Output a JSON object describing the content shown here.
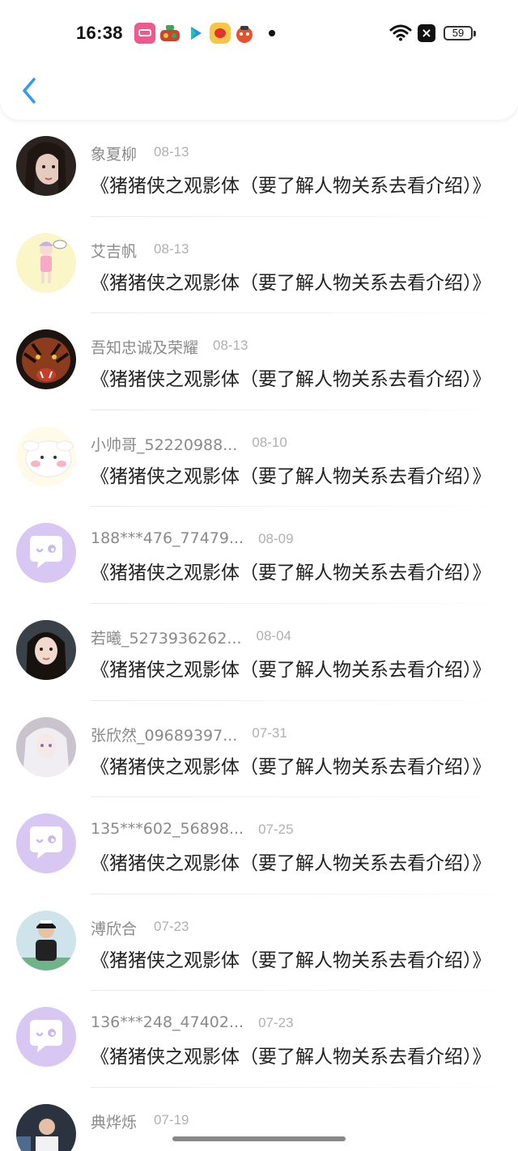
{
  "status_bar": {
    "time": "16:38",
    "battery": "59"
  },
  "header": {
    "back_icon": "chevron-left-icon",
    "accent": "#2c9cf0"
  },
  "avatar_bg": {
    "placeholder": "#d8c7f3"
  },
  "rows": [
    {
      "name": "象夏柳",
      "date": "08-13",
      "message": "《猪猪侠之观影体（要了解人物关系去看介绍）》",
      "avatar": "photo-girl"
    },
    {
      "name": "艾吉帆",
      "date": "08-13",
      "message": "《猪猪侠之观影体（要了解人物关系去看介绍）》",
      "avatar": "illustration-girl"
    },
    {
      "name": "吾知忠诚及荣耀",
      "date": "08-13",
      "message": "《猪猪侠之观影体（要了解人物关系去看介绍）》",
      "avatar": "photo-tiger"
    },
    {
      "name": "小帅哥_52220988...",
      "date": "08-10",
      "message": "《猪猪侠之观影体（要了解人物关系去看介绍）》",
      "avatar": "cartoon-sheep"
    },
    {
      "name": "188***476_77479...",
      "date": "08-09",
      "message": "《猪猪侠之观影体（要了解人物关系去看介绍）》",
      "avatar": "default-chat"
    },
    {
      "name": "若曦_5273936262...",
      "date": "08-04",
      "message": "《猪猪侠之观影体（要了解人物关系去看介绍）》",
      "avatar": "photo-girl-2"
    },
    {
      "name": "张欣然_09689397...",
      "date": "07-31",
      "message": "《猪猪侠之观影体（要了解人物关系去看介绍）》",
      "avatar": "illustration-white-hair"
    },
    {
      "name": "135***602_56898...",
      "date": "07-25",
      "message": "《猪猪侠之观影体（要了解人物关系去看介绍）》",
      "avatar": "default-chat"
    },
    {
      "name": "溥欣合",
      "date": "07-23",
      "message": "《猪猪侠之观影体（要了解人物关系去看介绍）》",
      "avatar": "photo-boy-cap"
    },
    {
      "name": "136***248_47402...",
      "date": "07-23",
      "message": "《猪猪侠之观影体（要了解人物关系去看介绍）》",
      "avatar": "default-chat"
    },
    {
      "name": "典烨烁",
      "date": "07-19",
      "message": "",
      "avatar": "photo-partial"
    }
  ]
}
